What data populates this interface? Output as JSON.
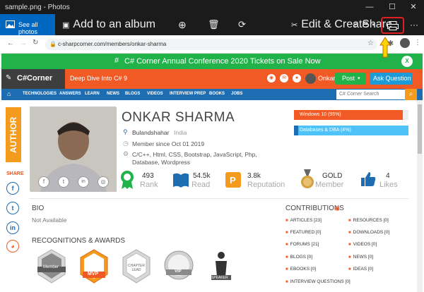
{
  "window": {
    "title": "sample.png - Photos"
  },
  "toolbar": {
    "see_all": "See all photos",
    "add_album": "Add to an album",
    "edit_create": "Edit & Create",
    "share": "Share"
  },
  "browser": {
    "url": "c-sharpcorner.com/members/onkar-sharma"
  },
  "banner": {
    "text": "C# Corner Annual Conference 2020 Tickets on Sale Now",
    "close": "X"
  },
  "site": {
    "logo": "C#Corner",
    "tagline": "Deep Dive Into C# 9",
    "user": "Onkar",
    "post": "Post",
    "ask": "Ask Question",
    "search_placeholder": "C# Corner Search"
  },
  "nav": [
    "TECHNOLOGIES",
    "ANSWERS",
    "LEARN",
    "NEWS",
    "BLOGS",
    "VIDEOS",
    "INTERVIEW PREP",
    "BOOKS",
    "JOBS"
  ],
  "sidebar": {
    "author": "AUTHOR",
    "share": "SHARE"
  },
  "profile": {
    "name": "ONKAR SHARMA",
    "city": "Bulandshahar",
    "country": "India",
    "member_since": "Member since Oct 01 2019",
    "skills": "C/C++, Html, CSS, Bootstrap, JavaScript, Php, Database, Wordpress"
  },
  "stats": [
    {
      "value": "493",
      "label": "Rank"
    },
    {
      "value": "54.5k",
      "label": "Read"
    },
    {
      "value": "3.8k",
      "label": "Reputation"
    },
    {
      "value": "GOLD",
      "label": "Member"
    },
    {
      "value": "4",
      "label": "Likes"
    }
  ],
  "skill_bars": [
    {
      "label": "Windows 10 (95%)",
      "pct": 95
    },
    {
      "label": "Databases & DBA (4%)",
      "pct": 4
    }
  ],
  "bio": {
    "title": "BIO",
    "text": "Not Available"
  },
  "recognitions": {
    "title": "RECOGNITIONS & AWARDS",
    "badges": [
      "Member",
      "MVP",
      "CHAPTER LEAD",
      "VIP",
      "SPEAKER"
    ]
  },
  "contributions": {
    "title": "CONTRIBUTIONS",
    "left": [
      "ARTICLES [23]",
      "FEATURED [0]",
      "FORUMS [21]",
      "BLOGS [0]",
      "EBOOKS [0]",
      "INTERVIEW QUESTIONS [0]"
    ],
    "right": [
      "RESOURCES [0]",
      "DOWNLOADS [0]",
      "VIDEOS [0]",
      "NEWS [0]",
      "IDEAS [0]"
    ]
  },
  "colors": {
    "accent": "#f15a24",
    "blue": "#1e6db3",
    "green": "#21b24a"
  }
}
